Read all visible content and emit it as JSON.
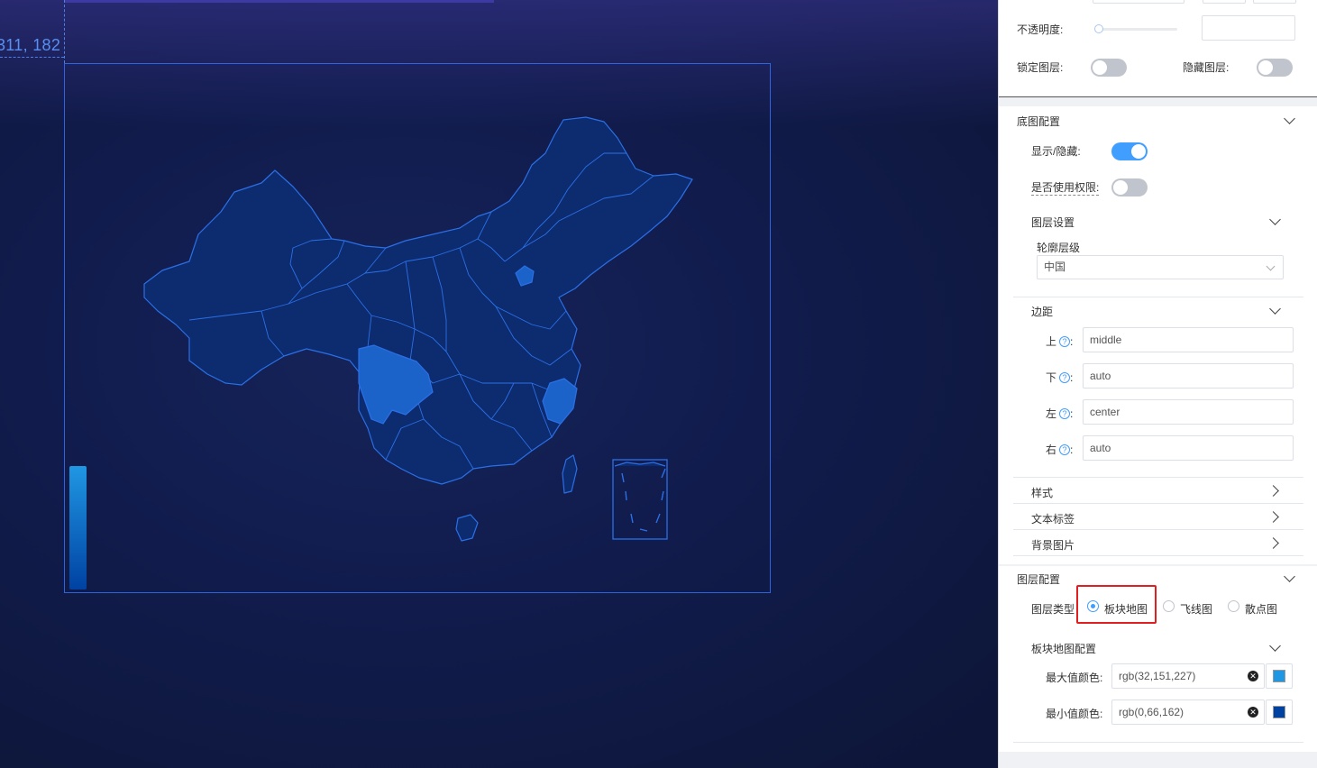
{
  "canvas": {
    "coord_readout": "311, 182",
    "map_colors": {
      "province_fill": "#0d2c6f",
      "province_stroke": "#2b6fe6",
      "highlight_fill": "#1c63c9",
      "legend_max": "#2097e3",
      "legend_min": "#0042a2"
    }
  },
  "panel": {
    "opacity_label": "不透明度:",
    "lock_layer_label": "锁定图层:",
    "hide_layer_label": "隐藏图层:",
    "basemap": {
      "title": "底图配置",
      "show_hide_label": "显示/隐藏:",
      "use_permission_label": "是否使用权限:",
      "layer_settings_title": "图层设置",
      "outline_level_label": "轮廓层级",
      "outline_level_value": "中国",
      "margin_title": "边距",
      "margin_top_label": "上",
      "margin_top_value": "middle",
      "margin_bottom_label": "下",
      "margin_bottom_value": "auto",
      "margin_left_label": "左",
      "margin_left_value": "center",
      "margin_right_label": "右",
      "margin_right_value": "auto",
      "style_title": "样式",
      "text_label_title": "文本标签",
      "bg_image_title": "背景图片"
    },
    "layer_config": {
      "title": "图层配置",
      "layer_type_label": "图层类型",
      "options": [
        "板块地图",
        "飞线图",
        "散点图"
      ],
      "selected": "板块地图",
      "block_map_title": "板块地图配置",
      "max_color_label": "最大值颜色:",
      "max_color_value": "rgb(32,151,227)",
      "max_color_hex": "#2097e3",
      "min_color_label": "最小值颜色:",
      "min_color_value": "rgb(0,66,162)",
      "min_color_hex": "#0042a2"
    }
  }
}
